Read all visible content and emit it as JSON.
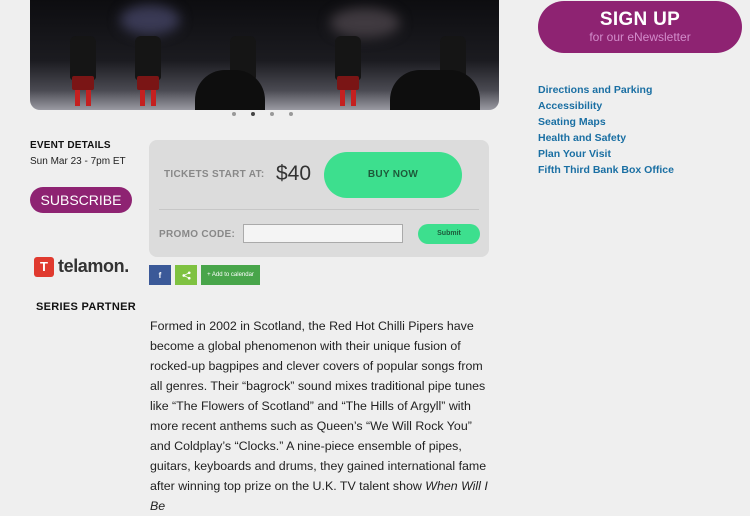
{
  "event": {
    "heading": "EVENT DETAILS",
    "date": "Sun Mar 23 - 7pm ET",
    "subscribe_label": "SUBSCRIBE"
  },
  "sponsor": {
    "logo_text": "telamon.",
    "partner_label": "SERIES PARTNER"
  },
  "tickets": {
    "label": "TICKETS START AT:",
    "price": "$40",
    "buy_label": "BUY NOW",
    "promo_label": "PROMO CODE:",
    "promo_value": "",
    "submit_label": "Submit"
  },
  "share": {
    "facebook_icon": "f",
    "share_icon": "share-icon",
    "calendar_label": "+ Add to calendar"
  },
  "description": {
    "text": "Formed in 2002 in Scotland, the Red Hot Chilli Pipers have become a global phenomenon with their unique fusion of rocked-up bagpipes and clever covers of popular songs from all genres. Their “bagrock” sound mixes traditional pipe tunes like “The Flowers of Scotland” and “The Hills of Argyll” with more recent anthems such as Queen’s “We Will Rock You” and Coldplay’s “Clocks.” A nine-piece ensemble of pipes, guitars, keyboards and drums, they gained international fame after winning top prize on the U.K. TV talent show ",
    "show_title": "When Will I Be"
  },
  "newsletter": {
    "title": "SIGN UP",
    "subtitle": "for our eNewsletter"
  },
  "sidebar_links": [
    "Directions and Parking",
    "Accessibility",
    "Seating Maps",
    "Health and Safety",
    "Plan Your Visit",
    "Fifth Third Bank Box Office"
  ],
  "carousel": {
    "slide_count": 4,
    "active_index": 1
  },
  "colors": {
    "accent": "#8e2372",
    "cta_green": "#3ddf8e",
    "link": "#1a6fa3"
  }
}
